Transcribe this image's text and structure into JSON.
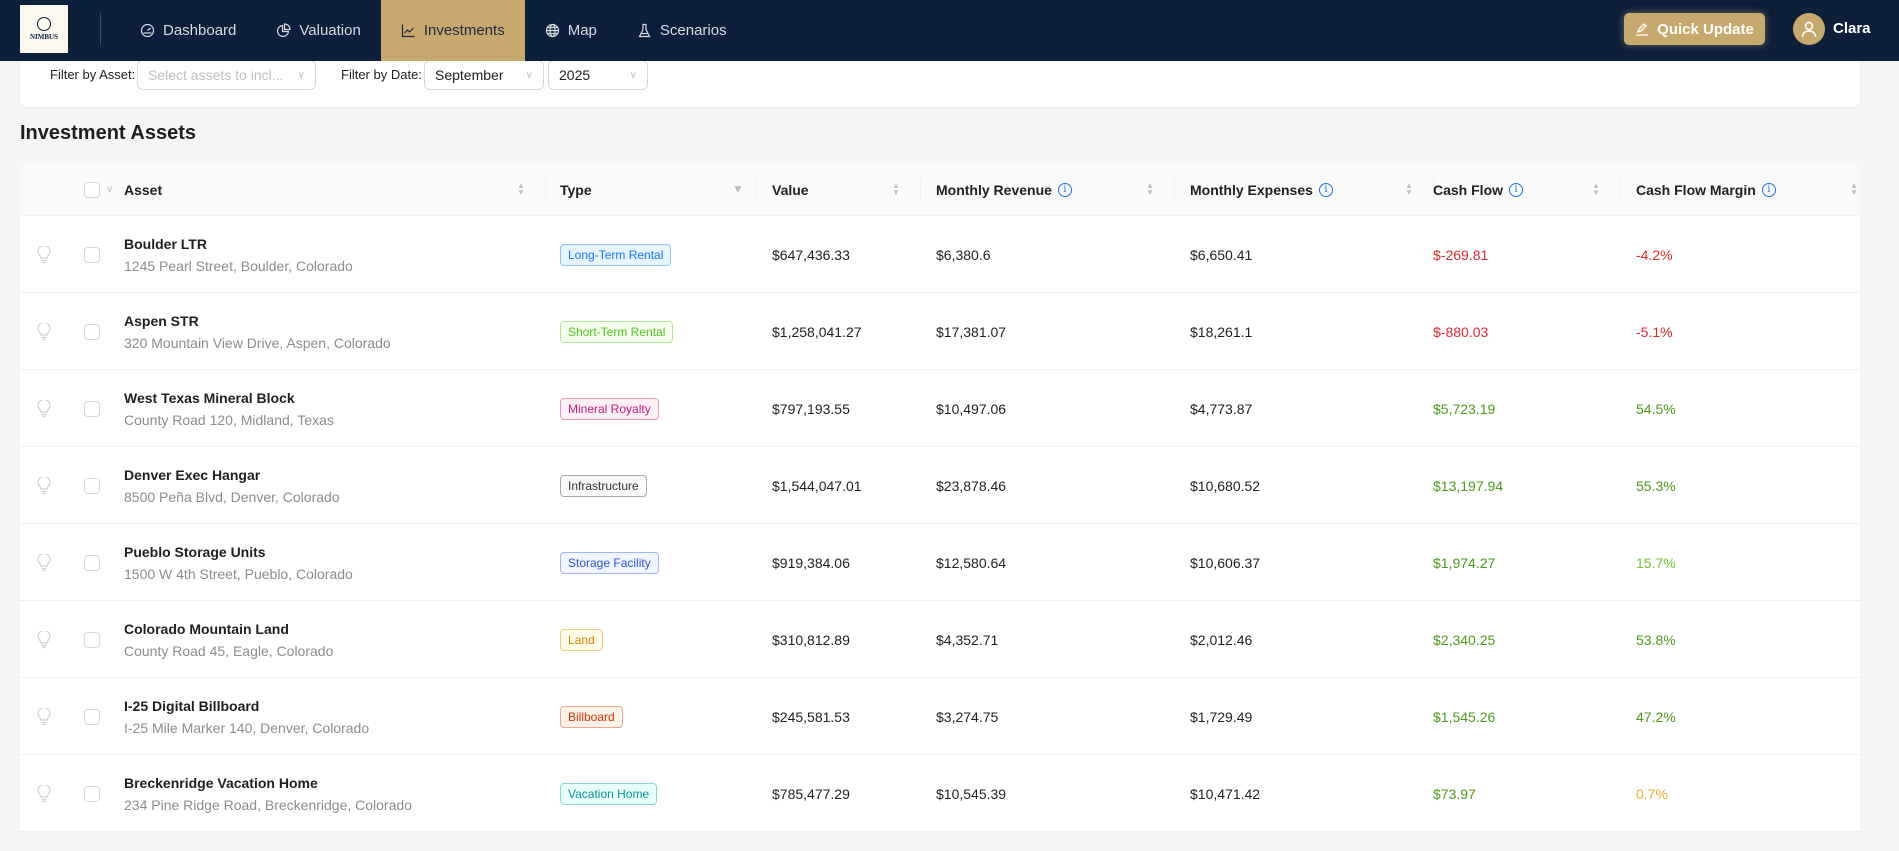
{
  "app": {
    "logo_text": "NIMBUS",
    "accent": "#c7a96d",
    "nav_bg": "#0c1f3b"
  },
  "nav": [
    {
      "label": "Dashboard",
      "icon": "dashboard-gauge-icon",
      "active": false
    },
    {
      "label": "Valuation",
      "icon": "pie-chart-icon",
      "active": false
    },
    {
      "label": "Investments",
      "icon": "line-chart-icon",
      "active": true
    },
    {
      "label": "Map",
      "icon": "globe-icon",
      "active": false
    },
    {
      "label": "Scenarios",
      "icon": "flask-icon",
      "active": false
    }
  ],
  "header": {
    "quick_update": "Quick Update",
    "user": "Clara"
  },
  "filters": {
    "asset_label": "Filter by Asset:",
    "asset_placeholder": "Select assets to incl...",
    "date_label": "Filter by Date:",
    "month": "September",
    "year": "2025"
  },
  "section_title": "Investment Assets",
  "columns": {
    "asset": "Asset",
    "type": "Type",
    "value": "Value",
    "revenue": "Monthly Revenue",
    "expenses": "Monthly Expenses",
    "cashflow": "Cash Flow",
    "margin": "Cash Flow Margin"
  },
  "rows": [
    {
      "name": "Boulder LTR",
      "address": "1245 Pearl Street, Boulder, Colorado",
      "type": "Long-Term Rental",
      "type_color": "#1677ff",
      "type_bg": "#e6f4ff",
      "value": "$647,436.33",
      "revenue": "$6,380.6",
      "expenses": "$6,650.41",
      "cashflow": "$-269.81",
      "margin": "-4.2%",
      "cf_class": "neg",
      "m_class": "neg"
    },
    {
      "name": "Aspen STR",
      "address": "320 Mountain View Drive, Aspen, Colorado",
      "type": "Short-Term Rental",
      "type_color": "#52c41a",
      "type_bg": "#f6ffed",
      "value": "$1,258,041.27",
      "revenue": "$17,381.07",
      "expenses": "$18,261.1",
      "cashflow": "$-880.03",
      "margin": "-5.1%",
      "cf_class": "neg",
      "m_class": "neg"
    },
    {
      "name": "West Texas Mineral Block",
      "address": "County Road 120, Midland, Texas",
      "type": "Mineral Royalty",
      "type_color": "#c41d7f",
      "type_bg": "#fff0f6",
      "value": "$797,193.55",
      "revenue": "$10,497.06",
      "expenses": "$4,773.87",
      "cashflow": "$5,723.19",
      "margin": "54.5%",
      "cf_class": "pos",
      "m_class": "pos"
    },
    {
      "name": "Denver Exec Hangar",
      "address": "8500 Peña Blvd, Denver, Colorado",
      "type": "Infrastructure",
      "type_color": "#333333",
      "type_bg": "#fafafa",
      "value": "$1,544,047.01",
      "revenue": "$23,878.46",
      "expenses": "$10,680.52",
      "cashflow": "$13,197.94",
      "margin": "55.3%",
      "cf_class": "pos",
      "m_class": "pos"
    },
    {
      "name": "Pueblo Storage Units",
      "address": "1500 W 4th Street, Pueblo, Colorado",
      "type": "Storage Facility",
      "type_color": "#2f54eb",
      "type_bg": "#f0f5ff",
      "value": "$919,384.06",
      "revenue": "$12,580.64",
      "expenses": "$10,606.37",
      "cashflow": "$1,974.27",
      "margin": "15.7%",
      "cf_class": "pos",
      "m_class": "light"
    },
    {
      "name": "Colorado Mountain Land",
      "address": "County Road 45, Eagle, Colorado",
      "type": "Land",
      "type_color": "#d48806",
      "type_bg": "#fffbe6",
      "value": "$310,812.89",
      "revenue": "$4,352.71",
      "expenses": "$2,012.46",
      "cashflow": "$2,340.25",
      "margin": "53.8%",
      "cf_class": "pos",
      "m_class": "pos"
    },
    {
      "name": "I-25 Digital Billboard",
      "address": "I-25 Mile Marker 140, Denver, Colorado",
      "type": "Billboard",
      "type_color": "#d4380d",
      "type_bg": "#fff2e8",
      "value": "$245,581.53",
      "revenue": "$3,274.75",
      "expenses": "$1,729.49",
      "cashflow": "$1,545.26",
      "margin": "47.2%",
      "cf_class": "pos",
      "m_class": "pos"
    },
    {
      "name": "Breckenridge Vacation Home",
      "address": "234 Pine Ridge Road, Breckenridge, Colorado",
      "type": "Vacation Home",
      "type_color": "#08979c",
      "type_bg": "#e6fffb",
      "value": "$785,477.29",
      "revenue": "$10,545.39",
      "expenses": "$10,471.42",
      "cashflow": "$73.97",
      "margin": "0.7%",
      "cf_class": "pos",
      "m_class": "warn"
    }
  ]
}
